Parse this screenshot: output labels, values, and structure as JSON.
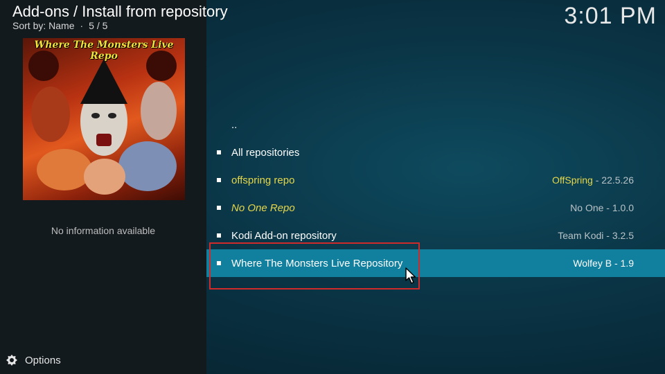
{
  "header": {
    "title": "Add-ons / Install from repository",
    "sort_label": "Sort by: Name",
    "separator": "·",
    "count": "5 / 5"
  },
  "clock": "3:01 PM",
  "poster": {
    "title": "Where The Monsters Live Repo"
  },
  "info_text": "No information available",
  "options_label": "Options",
  "list": {
    "parent": "..",
    "items": [
      {
        "label": "All repositories",
        "author": "",
        "sep": "",
        "version": ""
      },
      {
        "label": "offspring repo",
        "author": "OffSpring",
        "sep": " - ",
        "version": "22.5.26"
      },
      {
        "label": "No One Repo",
        "author": "No One",
        "sep": " - ",
        "version": "1.0.0"
      },
      {
        "label": "Kodi Add-on repository",
        "author": "Team Kodi",
        "sep": " - ",
        "version": "3.2.5"
      },
      {
        "label": "Where The Monsters Live Repository",
        "author": "Wolfey B",
        "sep": " - ",
        "version": "1.9"
      }
    ]
  },
  "colors": {
    "selected_bg": "#11809f",
    "highlight_text": "#e6d74a",
    "annotation_box": "#d02a2a"
  }
}
